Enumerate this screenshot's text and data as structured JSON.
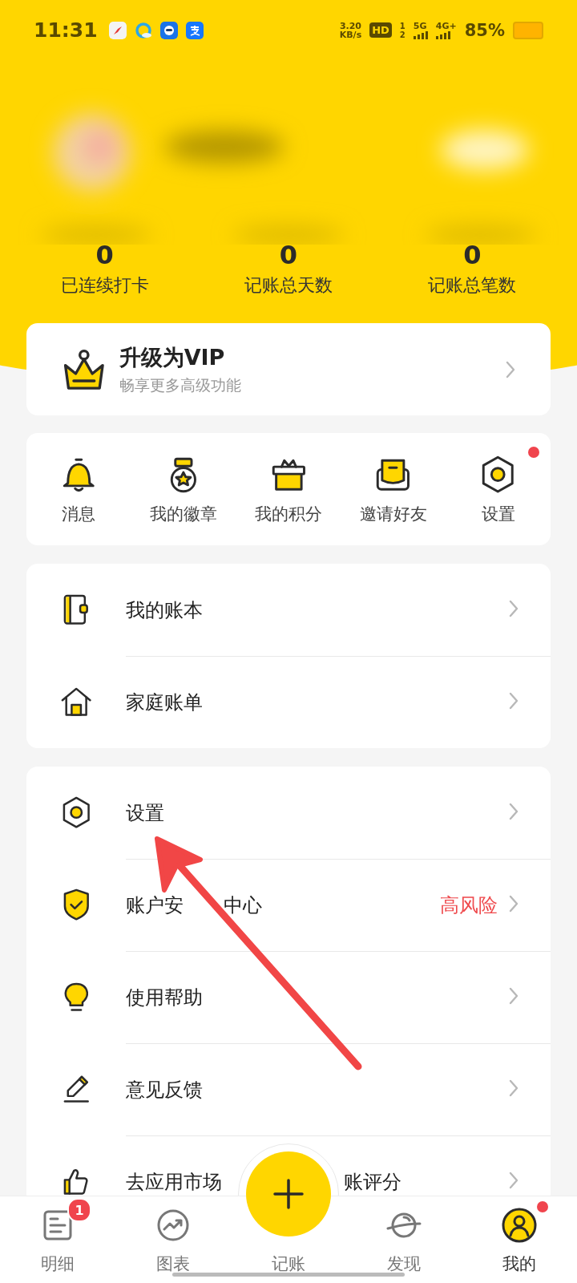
{
  "status_bar": {
    "time": "11:31",
    "speed": "3.20",
    "speed_unit": "KB/s",
    "hd": "HD",
    "sim_1": "1",
    "sim_2": "2",
    "net_1": "5G",
    "net_2": "4G+",
    "battery": "85%"
  },
  "profile": {
    "kind": "picture"
  },
  "stats": [
    {
      "value": "0",
      "label": "已连续打卡"
    },
    {
      "value": "0",
      "label": "记账总天数"
    },
    {
      "value": "0",
      "label": "记账总笔数"
    }
  ],
  "vip": {
    "title": "升级为VIP",
    "subtitle": "畅享更多高级功能"
  },
  "shortcuts": [
    {
      "label": "消息",
      "dot": false
    },
    {
      "label": "我的徽章",
      "dot": false
    },
    {
      "label": "我的积分",
      "dot": false
    },
    {
      "label": "邀请好友",
      "dot": false
    },
    {
      "label": "设置",
      "dot": true
    }
  ],
  "menu_groups": [
    [
      {
        "label": "我的账本"
      },
      {
        "label": "家庭账单"
      }
    ],
    [
      {
        "label": "设置"
      },
      {
        "label": "账户安",
        "label_end": "中心",
        "status": "高风险"
      },
      {
        "label": "使用帮助"
      },
      {
        "label": "意见反馈"
      },
      {
        "label": "去应用市场",
        "label_end": "账评分"
      }
    ]
  ],
  "tabs": [
    {
      "label": "明细",
      "badge": "1",
      "dot": false,
      "selected": false
    },
    {
      "label": "图表",
      "dot": false,
      "selected": false
    },
    {
      "label": "记账",
      "dot": false,
      "selected": false
    },
    {
      "label": "发现",
      "dot": false,
      "selected": false
    },
    {
      "label": "我的",
      "dot": true,
      "selected": true
    }
  ],
  "annotation": {
    "kind": "arrow"
  }
}
